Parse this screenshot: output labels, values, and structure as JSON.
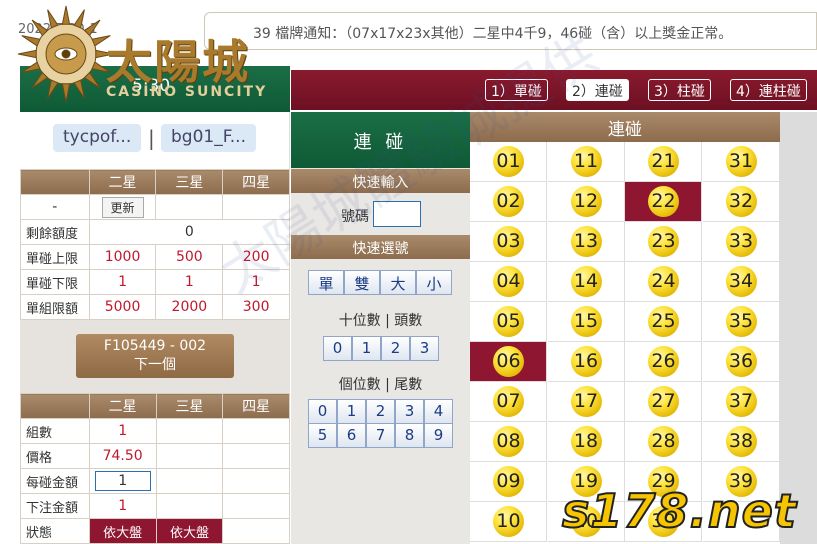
{
  "header": {
    "date_fragment": "2022/7/20-1",
    "notice": "39 檔牌通知：（07x17x23x其他）二星中4千9，46碰（含）以上獎金正常。"
  },
  "logo": {
    "title": "太陽城",
    "subtitle": "CASINO SUNCITY"
  },
  "clock": "5:30",
  "tabs": [
    {
      "label": "1）單碰",
      "active": false
    },
    {
      "label": "2）連碰",
      "active": true
    },
    {
      "label": "3）柱碰",
      "active": false
    },
    {
      "label": "4）連柱碰",
      "active": false
    }
  ],
  "users": {
    "user1": "tycpof...",
    "separator": "|",
    "user2": "bg01_F..."
  },
  "limits": {
    "headers": [
      "",
      "二星",
      "三星",
      "四星"
    ],
    "refresh_label": "更新",
    "dash": "-",
    "rows": [
      {
        "label": "剩餘額度",
        "value": "0"
      },
      {
        "label": "單碰上限",
        "values": [
          "1000",
          "500",
          "200"
        ]
      },
      {
        "label": "單碰下限",
        "values": [
          "1",
          "1",
          "1"
        ]
      },
      {
        "label": "單組限額",
        "values": [
          "5000",
          "2000",
          "300"
        ]
      }
    ]
  },
  "next": {
    "code": "F105449 - 002",
    "label": "下一個"
  },
  "order": {
    "headers": [
      "",
      "二星",
      "三星",
      "四星"
    ],
    "rows": [
      {
        "label": "組數",
        "value": "1"
      },
      {
        "label": "價格",
        "value": "74.50"
      },
      {
        "label": "每碰金額",
        "value": "1"
      },
      {
        "label": "下注金額",
        "value": "1"
      },
      {
        "label": "狀態",
        "values": [
          "依大盤",
          "依大盤"
        ]
      }
    ]
  },
  "middle": {
    "title": "連 碰",
    "quick_input": "快速輸入",
    "number_label": "號碼",
    "quick_select": "快速選號",
    "type_buttons": [
      "單",
      "雙",
      "大",
      "小"
    ],
    "tens_label": "十位數 | 頭數",
    "tens_buttons": [
      "0",
      "1",
      "2",
      "3"
    ],
    "units_label": "個位數 | 尾數",
    "units_buttons_row1": [
      "0",
      "1",
      "2",
      "3",
      "4"
    ],
    "units_buttons_row2": [
      "5",
      "6",
      "7",
      "8",
      "9"
    ]
  },
  "balls": {
    "title": "連碰",
    "selected": [
      "22",
      "06"
    ],
    "numbers": [
      "01",
      "11",
      "21",
      "31",
      "02",
      "12",
      "22",
      "32",
      "03",
      "13",
      "23",
      "33",
      "04",
      "14",
      "24",
      "34",
      "05",
      "15",
      "25",
      "35",
      "06",
      "16",
      "26",
      "36",
      "07",
      "17",
      "27",
      "37",
      "08",
      "18",
      "28",
      "38",
      "09",
      "19",
      "29",
      "39",
      "10",
      "20",
      "30",
      ""
    ]
  },
  "watermark": "太陽城體驗城提供",
  "brand_watermark": "s178.net",
  "colors": {
    "green": "#0f5a36",
    "maroon": "#8e1630",
    "tan": "#9c7b5b",
    "ball": "#ffe33a"
  }
}
